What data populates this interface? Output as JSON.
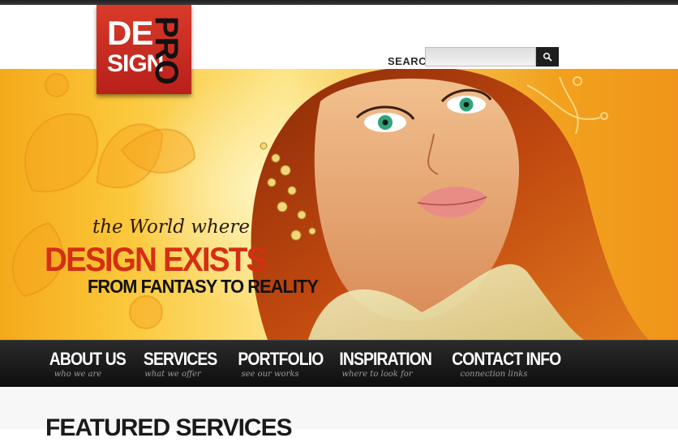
{
  "logo": {
    "line1": "DE",
    "line2": "SIGN",
    "line3": "PRO",
    "color": "#c82a1f"
  },
  "search": {
    "label": "SEARCH",
    "value": "",
    "placeholder": "",
    "button_icon": "search-icon"
  },
  "hero": {
    "line1": "the World where",
    "line2": "DESIGN EXISTS",
    "line3": "FROM FANTASY TO REALITY",
    "accent_color": "#d42f14"
  },
  "nav": {
    "items": [
      {
        "label": "ABOUT US",
        "sub": "who we are"
      },
      {
        "label": "SERVICES",
        "sub": "what we offer"
      },
      {
        "label": "PORTFOLIO",
        "sub": "see our works"
      },
      {
        "label": "INSPIRATION",
        "sub": "where to look for"
      },
      {
        "label": "CONTACT INFO",
        "sub": "connection links"
      }
    ]
  },
  "content": {
    "heading": "FEATURED SERVICES"
  }
}
